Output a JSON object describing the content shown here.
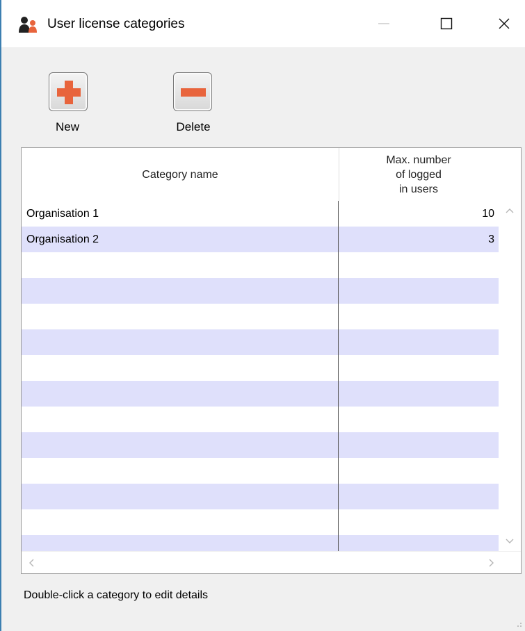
{
  "window": {
    "title": "User license categories",
    "controls": {
      "minimize": "—",
      "maximize": "☐",
      "close": "✕"
    }
  },
  "toolbar": {
    "new_label": "New",
    "delete_label": "Delete",
    "new_icon": "plus-icon",
    "delete_icon": "minus-icon",
    "icon_color": "#e8643c"
  },
  "table": {
    "columns": [
      "Category name",
      "Max. number\nof logged\nin users"
    ],
    "rows": [
      {
        "name": "Organisation 1",
        "max": "10"
      },
      {
        "name": "Organisation 2",
        "max": "3"
      }
    ],
    "alt_row_color": "#dfe0fb"
  },
  "status": {
    "text": "Double-click a category to edit details"
  }
}
